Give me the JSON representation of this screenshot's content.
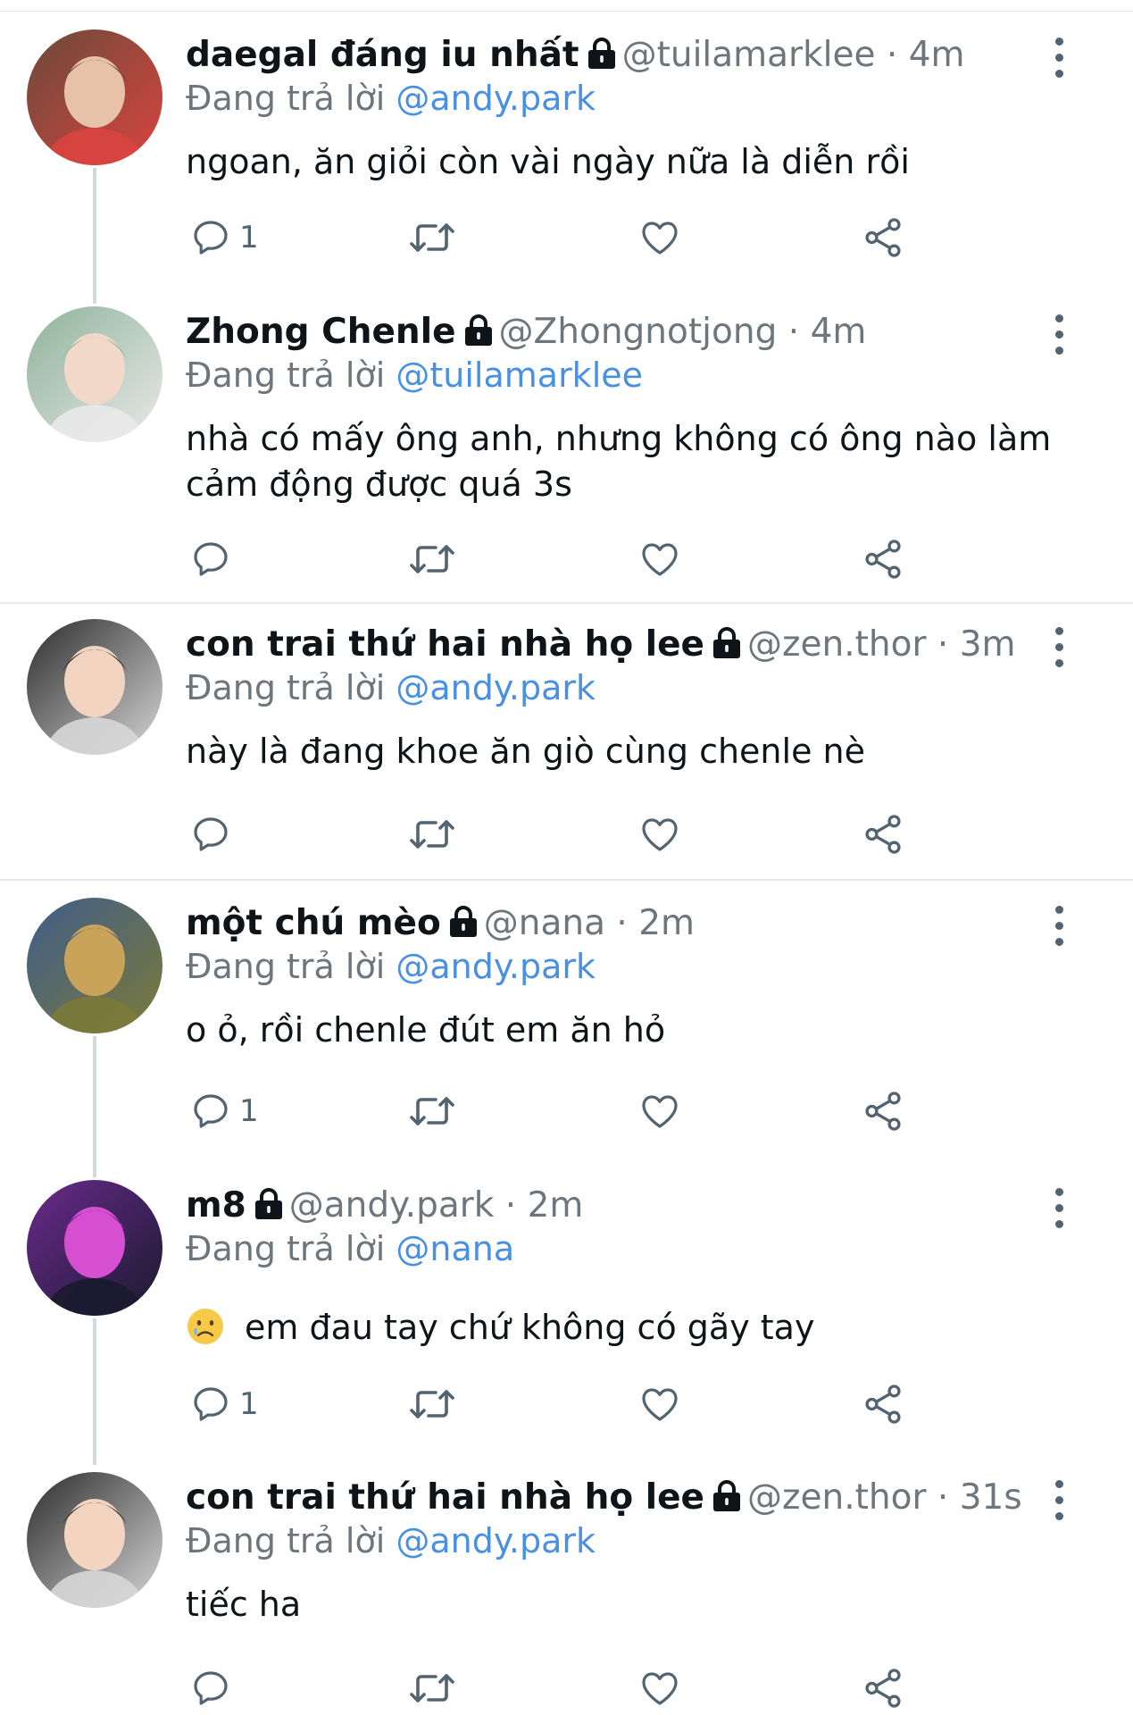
{
  "tweets": [
    {
      "name": "daegal đáng iu nhất",
      "handle": "@tuilamarklee",
      "time": "4m",
      "reply_label": "Đang trả lời",
      "reply_to": "@andy.park",
      "text": "ngoan, ăn giỏi còn vài ngày nữa là diễn rồi",
      "reply_count": "1",
      "avatar_colors": [
        "#6b4a3a",
        "#e8c2a8",
        "#d9443f"
      ]
    },
    {
      "name": "Zhong Chenle",
      "handle": "@Zhongnotjong",
      "time": "4m",
      "reply_label": "Đang trả lời",
      "reply_to": "@tuilamarklee",
      "text": "nhà có mấy ông anh, nhưng không có ông nào làm cảm động được quá 3s",
      "reply_count": "",
      "avatar_colors": [
        "#8fb39a",
        "#f1d8c8",
        "#e9e9e9"
      ]
    },
    {
      "name": "con trai thứ hai nhà họ lee",
      "handle": "@zen.thor",
      "time": "3m",
      "reply_label": "Đang trả lời",
      "reply_to": "@andy.park",
      "text": "này là đang khoe ăn giò cùng chenle nè",
      "reply_count": "",
      "avatar_colors": [
        "#2c2c2c",
        "#f2d4c0",
        "#d7d7d7"
      ]
    },
    {
      "name": "một chú mèo",
      "handle": "@nana",
      "time": "2m",
      "reply_label": "Đang trả lời",
      "reply_to": "@andy.park",
      "text": "o ỏ, rồi chenle đút em ăn hỏ",
      "reply_count": "1",
      "avatar_colors": [
        "#3f5d8a",
        "#c9a35a",
        "#7c7a3a"
      ]
    },
    {
      "name": "m8",
      "handle": "@andy.park",
      "time": "2m",
      "reply_label": "Đang trả lời",
      "reply_to": "@nana",
      "text": "em đau tay chứ không có gãy tay",
      "emoji": "sad-face-emoji",
      "reply_count": "1",
      "avatar_colors": [
        "#6a2a8c",
        "#d64fd1",
        "#1a1a2e"
      ]
    },
    {
      "name": "con trai thứ hai nhà họ lee",
      "handle": "@zen.thor",
      "time": "31s",
      "reply_label": "Đang trả lời",
      "reply_to": "@andy.park",
      "text": "tiếc ha",
      "reply_count": "",
      "avatar_colors": [
        "#2c2c2c",
        "#f2d4c0",
        "#d7d7d7"
      ]
    }
  ],
  "separator": "·",
  "icons": {
    "reply": "reply-icon",
    "retweet": "retweet-icon",
    "like": "like-icon",
    "share": "share-icon",
    "more": "more-options-icon",
    "lock": "lock-icon"
  },
  "colors": {
    "mention": "#4a90e2",
    "muted": "#6e767d",
    "icon": "#536471",
    "divider": "#e6e9ec",
    "thread": "#cfd9de"
  }
}
